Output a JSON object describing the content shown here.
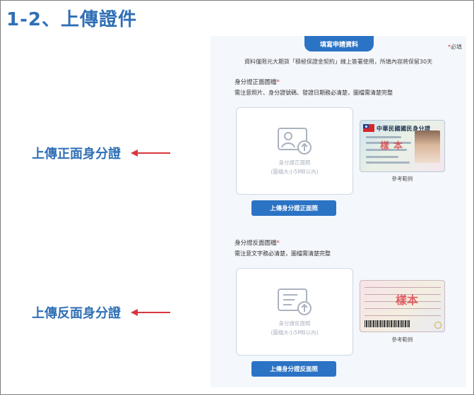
{
  "page": {
    "title": "1-2、上傳證件"
  },
  "callouts": {
    "front": "上傳正面身分證",
    "back": "上傳反面身分證"
  },
  "form": {
    "header": "填寫申請資料",
    "required_mark": "*",
    "required_note": "必填",
    "intro": "資料僅限元大期貨「積極保證金契約」線上簽署使用，所填內容將保留30天",
    "front": {
      "label": "身分證正面圖檔",
      "note": "需注意照片、身分證號碼、發證日期務必清楚，圖檔需清楚完整",
      "placeholder_title": "身分證正面照",
      "placeholder_hint": "(圖檔大小5MB以內)",
      "button": "上傳身分證正面照",
      "sample_caption": "參考範例",
      "sample_title": "中華民國國民身分證",
      "sample_stamp": "樣本",
      "icon": "id-card-front-upload-icon"
    },
    "back": {
      "label": "身分證反面圖檔",
      "note": "需注意文字務必清楚，圖檔需清楚完整",
      "placeholder_title": "身分證反面照",
      "placeholder_hint": "(圖檔大小5MB以內)",
      "button": "上傳身分證反面照",
      "sample_caption": "參考範例",
      "sample_stamp": "樣本",
      "icon": "id-card-back-upload-icon"
    }
  },
  "colors": {
    "title_blue": "#2f6fb5",
    "button_blue": "#2b73c4",
    "arrow_red": "#d9363e"
  }
}
